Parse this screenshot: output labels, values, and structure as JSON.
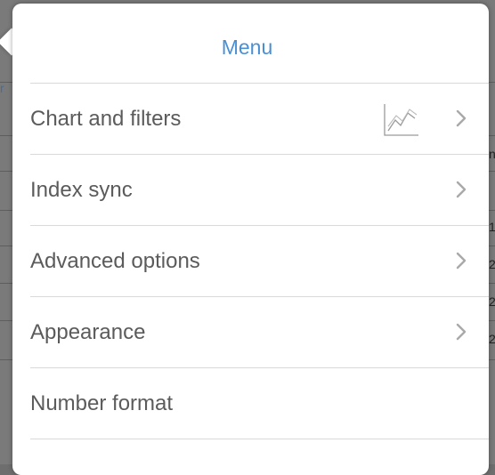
{
  "menu": {
    "title": "Menu",
    "items": [
      {
        "label": "Chart and filters",
        "icon": "line-chart-icon",
        "has_submenu": true
      },
      {
        "label": "Index sync",
        "has_submenu": true
      },
      {
        "label": "Advanced options",
        "has_submenu": true
      },
      {
        "label": "Appearance",
        "has_submenu": true
      },
      {
        "label": "Number format",
        "has_submenu": false
      }
    ]
  },
  "background": {
    "fragments": [
      "r",
      "n",
      "1",
      "2",
      "2",
      "2"
    ]
  },
  "colors": {
    "title": "#4a8fd4",
    "label": "#5b5b5b",
    "divider": "#d9d9d9",
    "chevron": "#a9a9a9",
    "icon": "#9a9a9a",
    "backdrop": "#7a7a7a"
  }
}
